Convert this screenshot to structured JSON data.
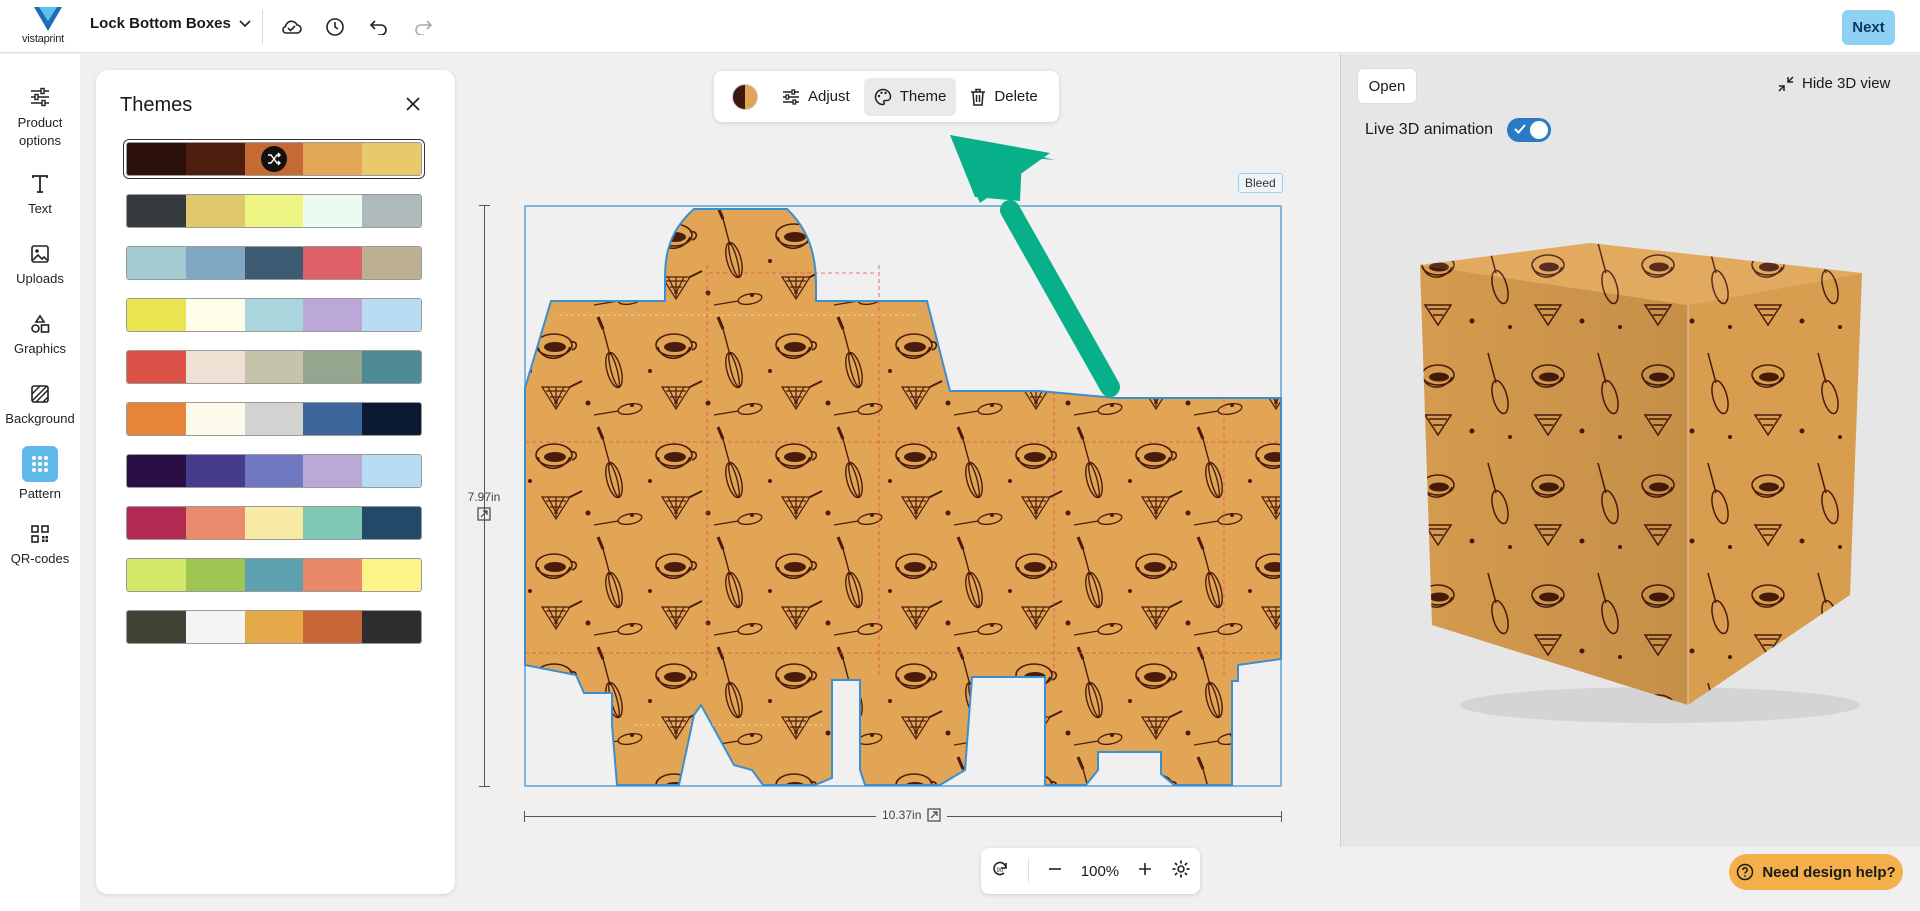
{
  "topbar": {
    "logo_text": "vistaprint",
    "project_title": "Lock Bottom Boxes",
    "next_label": "Next"
  },
  "rail": {
    "items": [
      {
        "label": "Product options",
        "icon": "sliders-icon"
      },
      {
        "label": "Text",
        "icon": "text-icon"
      },
      {
        "label": "Uploads",
        "icon": "image-icon"
      },
      {
        "label": "Graphics",
        "icon": "shapes-icon"
      },
      {
        "label": "Background",
        "icon": "background-icon"
      },
      {
        "label": "Pattern",
        "icon": "pattern-icon",
        "active": true
      },
      {
        "label": "QR-codes",
        "icon": "qr-icon"
      }
    ]
  },
  "themes_panel": {
    "title": "Themes",
    "themes": [
      {
        "colors": [
          "#2a0f0a",
          "#4e1e0e",
          "#c46a32",
          "#e1a656",
          "#e8c96b"
        ],
        "selected": true
      },
      {
        "colors": [
          "#353a3e",
          "#e0c86c",
          "#eef583",
          "#ecfbf2",
          "#afbbbb"
        ]
      },
      {
        "colors": [
          "#a4cad1",
          "#80a8c5",
          "#3d5b73",
          "#de5f65",
          "#bdaf91"
        ]
      },
      {
        "colors": [
          "#ebe451",
          "#fdfde8",
          "#a8d6dc",
          "#bba8d8",
          "#b9dcf3"
        ]
      },
      {
        "colors": [
          "#dc5249",
          "#ede1d3",
          "#c5c3a9",
          "#95a68e",
          "#4e8b94"
        ]
      },
      {
        "colors": [
          "#e8833a",
          "#fdfbeb",
          "#d2d3d1",
          "#3d669b",
          "#0b1a32"
        ]
      },
      {
        "colors": [
          "#2a0f45",
          "#453c8c",
          "#7077c1",
          "#bba8d8",
          "#b8dcf3"
        ]
      },
      {
        "colors": [
          "#b22a51",
          "#e98a6c",
          "#f7eaa2",
          "#7ec8b4",
          "#224b69"
        ]
      },
      {
        "colors": [
          "#d3e768",
          "#9fc652",
          "#5ea1ae",
          "#e98866",
          "#fbf488"
        ]
      },
      {
        "colors": [
          "#3f4434",
          "#f4f4f4",
          "#e6a94a",
          "#c86735",
          "#2d2d2d"
        ]
      }
    ]
  },
  "context_toolbar": {
    "adjust_label": "Adjust",
    "theme_label": "Theme",
    "delete_label": "Delete"
  },
  "canvas": {
    "bleed_label": "Bleed",
    "height_label": "7.97in",
    "width_label": "10.37in",
    "zoom_value": "100%"
  },
  "preview": {
    "open_label": "Open",
    "hide_label": "Hide 3D view",
    "live_label": "Live 3D animation",
    "live_enabled": true
  },
  "help": {
    "label": "Need design help?"
  },
  "colors": {
    "pattern_bg": "#e2a555",
    "pattern_ink": "#4a1c0c",
    "accent": "#8fd1f2",
    "arrow": "#08b08a"
  }
}
